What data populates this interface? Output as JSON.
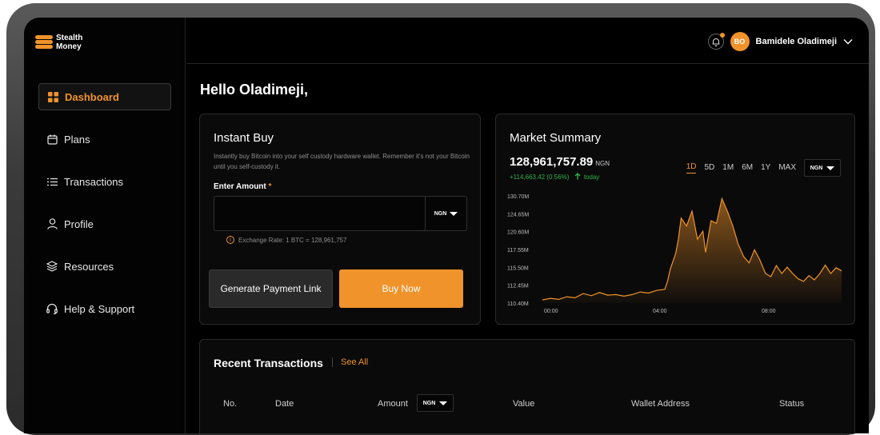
{
  "app": {
    "logo_line1": "Stealth",
    "logo_line2": "Money"
  },
  "brand_colors": {
    "accent": "#f0932b",
    "positive": "#2fb14a",
    "background": "#000000"
  },
  "sidebar": {
    "items": [
      {
        "label": "Dashboard",
        "icon": "grid-icon",
        "active": true
      },
      {
        "label": "Plans",
        "icon": "calendar-icon"
      },
      {
        "label": "Transactions",
        "icon": "list-icon"
      },
      {
        "label": "Profile",
        "icon": "user-icon"
      },
      {
        "label": "Resources",
        "icon": "layers-icon"
      },
      {
        "label": "Help & Support",
        "icon": "headset-icon"
      }
    ]
  },
  "header": {
    "avatar_initials": "BO",
    "user_name": "Bamidele Oladimeji"
  },
  "greeting": "Hello Oladimeji,",
  "instant_buy": {
    "title": "Instant Buy",
    "description": "Instantly buy Bitcoin into your self custody hardware wallet. Remember it's not your Bitcoin until you self-custody it.",
    "amount_label": "Enter Amount",
    "required_mark": "*",
    "amount_value": "",
    "currency": "NGN",
    "exchange_rate": "Exchange Rate: 1 BTC = 128,961,757",
    "generate_label": "Generate Payment Link",
    "buy_label": "Buy Now"
  },
  "market": {
    "title": "Market Summary",
    "price": "128,961,757.89",
    "price_unit": "NGN",
    "change": "+114,663.42 (0.56%)",
    "change_period": "today",
    "ranges": [
      "1D",
      "5D",
      "1M",
      "6M",
      "1Y",
      "MAX"
    ],
    "active_range": "1D",
    "currency": "NGN"
  },
  "chart_data": {
    "type": "area",
    "y_tick_labels": [
      "130.70M",
      "124.65M",
      "120.60M",
      "117.55M",
      "115.50M",
      "112.45M",
      "110.40M"
    ],
    "x_tick_labels": [
      "00:00",
      "04:00",
      "08:00"
    ],
    "ylim": [
      110.4,
      130.7
    ],
    "x_hours": [
      0,
      0.3,
      0.6,
      0.9,
      1.2,
      1.5,
      1.8,
      2.1,
      2.4,
      2.7,
      3.0,
      3.3,
      3.6,
      3.9,
      4.2,
      4.5,
      4.6,
      4.7,
      4.9,
      5.0,
      5.1,
      5.3,
      5.5,
      5.7,
      5.9,
      6.0,
      6.2,
      6.4,
      6.6,
      6.8,
      7.0,
      7.2,
      7.4,
      7.6,
      7.8,
      8.0,
      8.2,
      8.4,
      8.6,
      8.8,
      9.0,
      9.2,
      9.4,
      9.6,
      9.8,
      10.0,
      10.2,
      10.4,
      10.6,
      10.8,
      11.0
    ],
    "values": [
      111.0,
      111.3,
      111.1,
      111.6,
      111.4,
      112.2,
      111.8,
      112.4,
      111.9,
      112.0,
      111.7,
      112.0,
      112.5,
      112.3,
      112.8,
      113.0,
      114.5,
      116.8,
      119.8,
      122.5,
      126.5,
      125.0,
      127.8,
      122.5,
      124.0,
      120.0,
      126.0,
      125.5,
      130.2,
      127.8,
      125.0,
      121.5,
      119.2,
      118.0,
      120.5,
      118.5,
      116.0,
      115.4,
      117.5,
      116.0,
      117.2,
      116.0,
      115.0,
      114.5,
      115.6,
      114.8,
      116.0,
      117.6,
      116.0,
      117.1,
      116.5
    ]
  },
  "recent": {
    "title": "Recent Transactions",
    "see_all": "See All",
    "columns": [
      "No.",
      "Date",
      "Amount",
      "Value",
      "Wallet Address",
      "Status"
    ],
    "amount_currency": "NGN"
  }
}
